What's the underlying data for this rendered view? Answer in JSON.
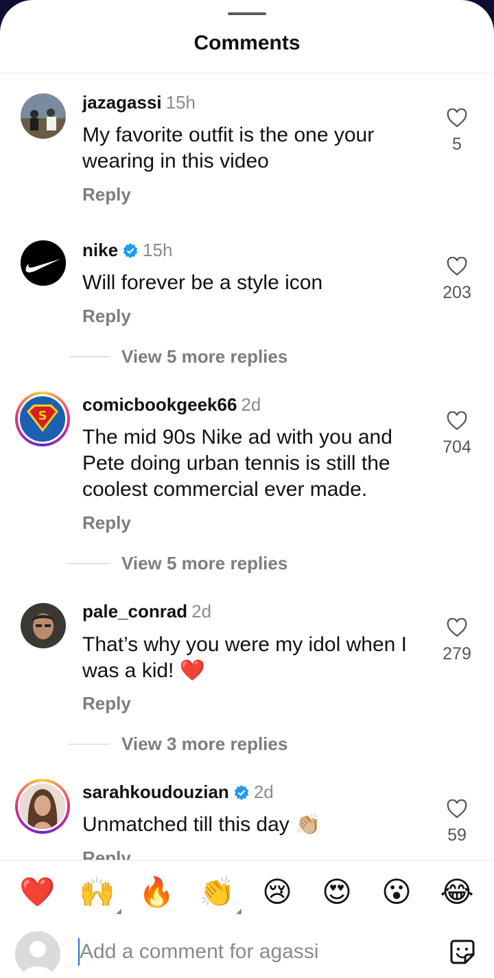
{
  "header": {
    "title": "Comments"
  },
  "comments": [
    {
      "username": "jazagassi",
      "time": "15h",
      "verified": false,
      "text": "My favorite outfit is the one your wearing in this video",
      "reply_label": "Reply",
      "like_count": "5",
      "avatar": "photo-people-icon"
    },
    {
      "username": "nike",
      "time": "15h",
      "verified": true,
      "text": "Will forever be a style icon",
      "reply_label": "Reply",
      "like_count": "203",
      "view_more": "View 5 more replies",
      "avatar": "nike-swoosh-logo"
    },
    {
      "username": "comicbookgeek66",
      "time": "2d",
      "verified": false,
      "text": "The mid 90s Nike ad with you and Pete doing urban tennis is still the coolest commercial ever made.",
      "reply_label": "Reply",
      "like_count": "704",
      "view_more": "View 5 more replies",
      "avatar": "superman-logo"
    },
    {
      "username": "pale_conrad",
      "time": "2d",
      "verified": false,
      "text": "That’s why you were my idol when I was a kid! ❤️",
      "reply_label": "Reply",
      "like_count": "279",
      "view_more": "View 3 more replies",
      "avatar": "photo-man-icon"
    },
    {
      "username": "sarahkoudouzian",
      "time": "2d",
      "verified": true,
      "text": "Unmatched till this day 👏🏼",
      "reply_label": "Reply",
      "like_count": "59",
      "avatar": "photo-woman-icon"
    }
  ],
  "quick_reactions": [
    "❤️",
    "🙌",
    "🔥",
    "👏",
    "😢",
    "😍",
    "😮",
    "😂"
  ],
  "composer": {
    "placeholder": "Add a comment for agassi",
    "sticker_icon": "sticker-icon"
  },
  "colors": {
    "verified": "#1d9bf0",
    "muted_text": "#8a8a8a",
    "story_ring": "#ee2a7b"
  }
}
